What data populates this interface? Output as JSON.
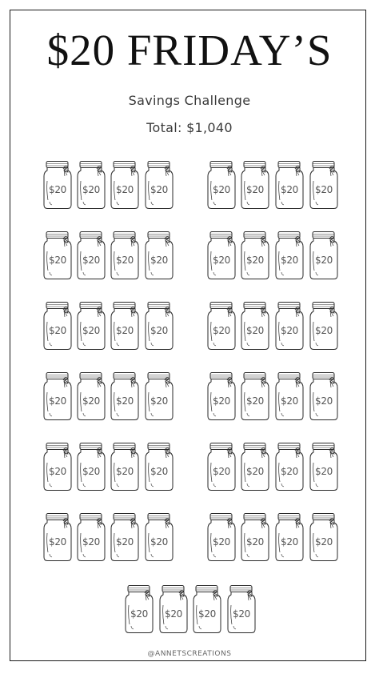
{
  "title": "$20 FRIDAY’S",
  "subtitle": "Savings Challenge",
  "total": "Total: $1,040",
  "jar_amount": "$20",
  "jar_count": 52,
  "footer": "@ANNETSCREATIONS"
}
